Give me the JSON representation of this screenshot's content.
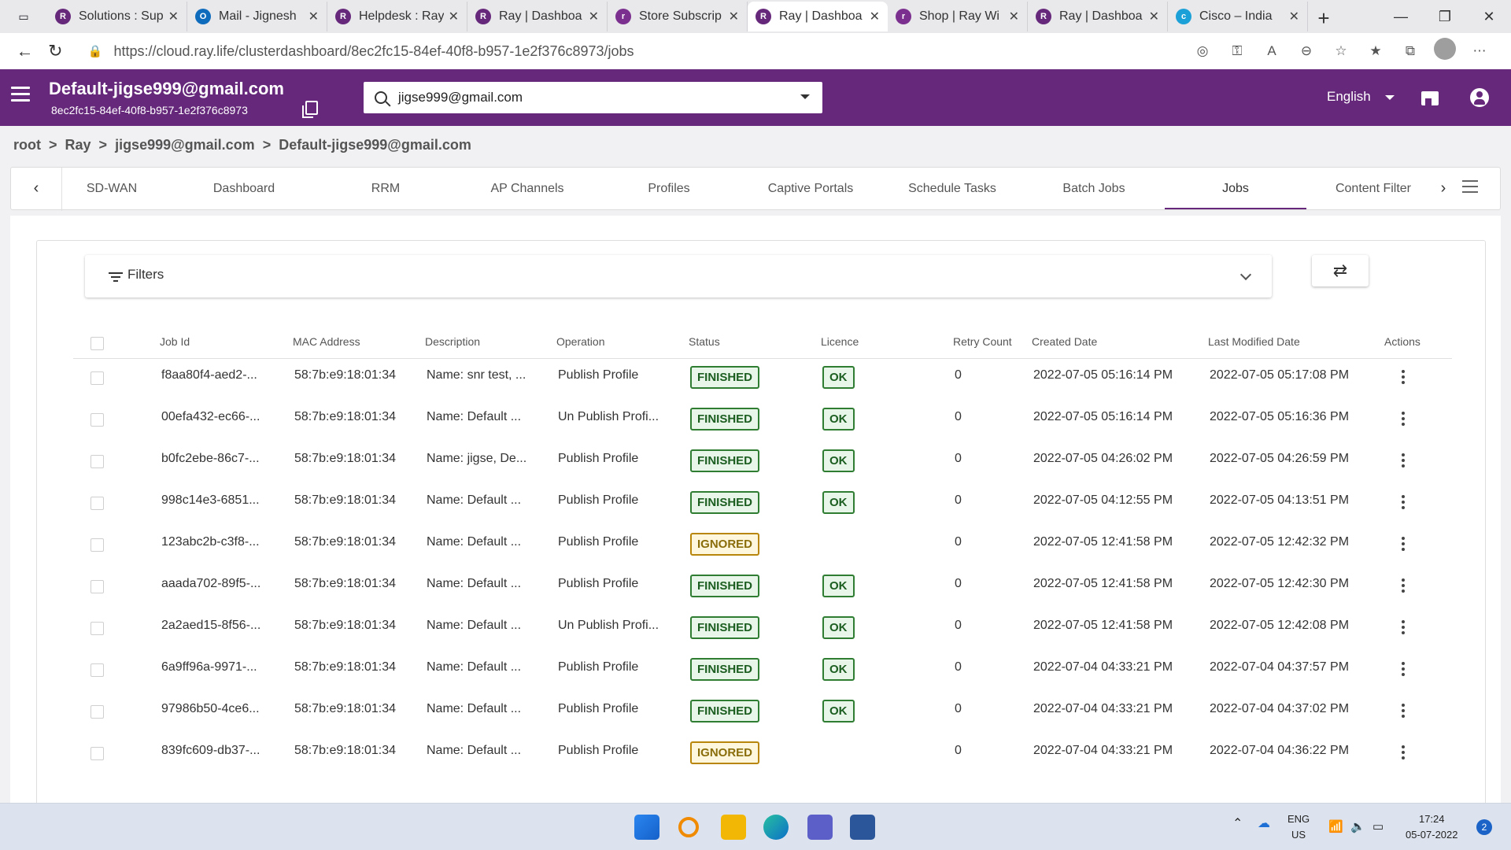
{
  "browser": {
    "tabs": [
      {
        "title": "Solutions : Sup",
        "color": "#66287b",
        "glyph": "R"
      },
      {
        "title": "Mail - Jignesh",
        "color": "#0f6cbd",
        "glyph": "O"
      },
      {
        "title": "Helpdesk : Ray",
        "color": "#66287b",
        "glyph": "R"
      },
      {
        "title": "Ray | Dashboa",
        "color": "#66287b",
        "glyph": "R"
      },
      {
        "title": "Store Subscrip",
        "color": "#7b2f8e",
        "glyph": "r"
      },
      {
        "title": "Ray | Dashboa",
        "color": "#66287b",
        "glyph": "R"
      },
      {
        "title": "Shop | Ray Wi",
        "color": "#7b2f8e",
        "glyph": "r"
      },
      {
        "title": "Ray | Dashboa",
        "color": "#66287b",
        "glyph": "R"
      },
      {
        "title": "Cisco – India",
        "color": "#1ba0d7",
        "glyph": "c"
      }
    ],
    "url": "https://cloud.ray.life/clusterdashboard/8ec2fc15-84ef-40f8-b957-1e2f376c8973/jobs"
  },
  "header": {
    "org_title": "Default-jigse999@gmail.com",
    "org_id": "8ec2fc15-84ef-40f8-b957-1e2f376c8973",
    "search_value": "jigse999@gmail.com",
    "language": "English"
  },
  "breadcrumb": {
    "root": "root",
    "ray": "Ray",
    "user": "jigse999@gmail.com",
    "org": "Default-jigse999@gmail.com"
  },
  "nav_tabs": {
    "sdwan": "SD-WAN",
    "dashboard": "Dashboard",
    "rrm": "RRM",
    "ap_channels": "AP Channels",
    "profiles": "Profiles",
    "captive_portals": "Captive Portals",
    "schedule_tasks": "Schedule Tasks",
    "batch_jobs": "Batch Jobs",
    "jobs": "Jobs",
    "content_filter": "Content Filter"
  },
  "filters": {
    "label": "Filters"
  },
  "table": {
    "headers": {
      "job_id": "Job Id",
      "mac": "MAC Address",
      "description": "Description",
      "operation": "Operation",
      "status": "Status",
      "licence": "Licence",
      "retry": "Retry Count",
      "created": "Created Date",
      "modified": "Last Modified Date",
      "actions": "Actions"
    },
    "rows": [
      {
        "job_id": "f8aa80f4-aed2-...",
        "mac": "58:7b:e9:18:01:34",
        "description": "Name: snr test, ...",
        "operation": "Publish Profile",
        "status": "FINISHED",
        "licence": "OK",
        "retry": "0",
        "created": "2022-07-05 05:16:14 PM",
        "modified": "2022-07-05 05:17:08 PM"
      },
      {
        "job_id": "00efa432-ec66-...",
        "mac": "58:7b:e9:18:01:34",
        "description": "Name: Default ...",
        "operation": "Un Publish Profi...",
        "status": "FINISHED",
        "licence": "OK",
        "retry": "0",
        "created": "2022-07-05 05:16:14 PM",
        "modified": "2022-07-05 05:16:36 PM"
      },
      {
        "job_id": "b0fc2ebe-86c7-...",
        "mac": "58:7b:e9:18:01:34",
        "description": "Name: jigse, De...",
        "operation": "Publish Profile",
        "status": "FINISHED",
        "licence": "OK",
        "retry": "0",
        "created": "2022-07-05 04:26:02 PM",
        "modified": "2022-07-05 04:26:59 PM"
      },
      {
        "job_id": "998c14e3-6851...",
        "mac": "58:7b:e9:18:01:34",
        "description": "Name: Default ...",
        "operation": "Publish Profile",
        "status": "FINISHED",
        "licence": "OK",
        "retry": "0",
        "created": "2022-07-05 04:12:55 PM",
        "modified": "2022-07-05 04:13:51 PM"
      },
      {
        "job_id": "123abc2b-c3f8-...",
        "mac": "58:7b:e9:18:01:34",
        "description": "Name: Default ...",
        "operation": "Publish Profile",
        "status": "IGNORED",
        "licence": "",
        "retry": "0",
        "created": "2022-07-05 12:41:58 PM",
        "modified": "2022-07-05 12:42:32 PM"
      },
      {
        "job_id": "aaada702-89f5-...",
        "mac": "58:7b:e9:18:01:34",
        "description": "Name: Default ...",
        "operation": "Publish Profile",
        "status": "FINISHED",
        "licence": "OK",
        "retry": "0",
        "created": "2022-07-05 12:41:58 PM",
        "modified": "2022-07-05 12:42:30 PM"
      },
      {
        "job_id": "2a2aed15-8f56-...",
        "mac": "58:7b:e9:18:01:34",
        "description": "Name: Default ...",
        "operation": "Un Publish Profi...",
        "status": "FINISHED",
        "licence": "OK",
        "retry": "0",
        "created": "2022-07-05 12:41:58 PM",
        "modified": "2022-07-05 12:42:08 PM"
      },
      {
        "job_id": "6a9ff96a-9971-...",
        "mac": "58:7b:e9:18:01:34",
        "description": "Name: Default ...",
        "operation": "Publish Profile",
        "status": "FINISHED",
        "licence": "OK",
        "retry": "0",
        "created": "2022-07-04 04:33:21 PM",
        "modified": "2022-07-04 04:37:57 PM"
      },
      {
        "job_id": "97986b50-4ce6...",
        "mac": "58:7b:e9:18:01:34",
        "description": "Name: Default ...",
        "operation": "Publish Profile",
        "status": "FINISHED",
        "licence": "OK",
        "retry": "0",
        "created": "2022-07-04 04:33:21 PM",
        "modified": "2022-07-04 04:37:02 PM"
      },
      {
        "job_id": "839fc609-db37-...",
        "mac": "58:7b:e9:18:01:34",
        "description": "Name: Default ...",
        "operation": "Publish Profile",
        "status": "IGNORED",
        "licence": "",
        "retry": "0",
        "created": "2022-07-04 04:33:21 PM",
        "modified": "2022-07-04 04:36:22 PM"
      }
    ]
  },
  "taskbar": {
    "lang": "ENG",
    "region": "US",
    "time": "17:24",
    "date": "05-07-2022",
    "notifications": "2"
  },
  "colors": {
    "brand": "#66287b",
    "finished": "#2e7d32",
    "ignored": "#b8860b"
  }
}
